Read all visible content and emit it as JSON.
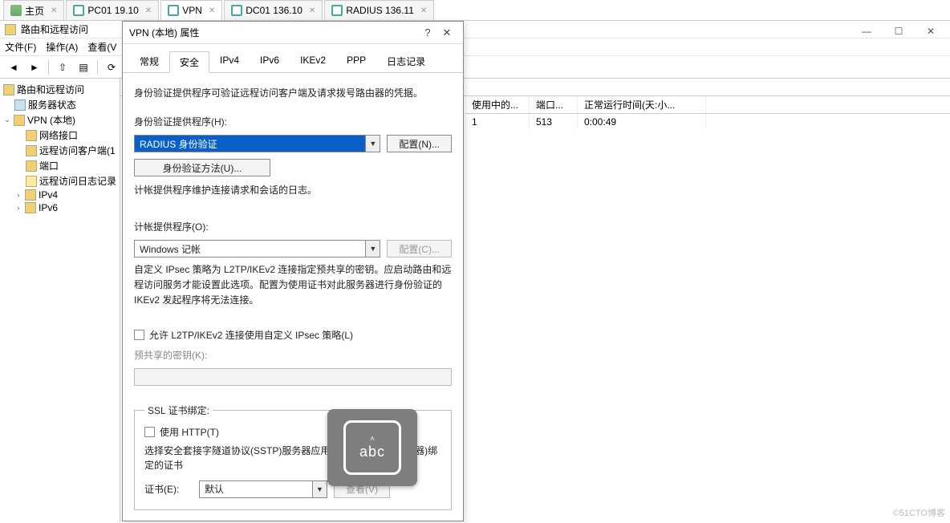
{
  "top_tabs": [
    {
      "label": "主页",
      "type": "home"
    },
    {
      "label": "PC01  19.10",
      "type": "pc"
    },
    {
      "label": "VPN",
      "type": "pc",
      "active": true
    },
    {
      "label": "DC01  136.10",
      "type": "pc"
    },
    {
      "label": "RADIUS  136.11",
      "type": "pc"
    }
  ],
  "mmc_title": "路由和远程访问",
  "menu": {
    "file": "文件(F)",
    "action": "操作(A)",
    "view": "查看(V"
  },
  "tree": {
    "root": "路由和远程访问",
    "server_status": "服务器状态",
    "vpn_local": "VPN (本地)",
    "net_if": "网络接口",
    "ras_clients": "远程访问客户端(1",
    "ports": "端口",
    "ras_log": "远程访问日志记录",
    "ipv4": "IPv4",
    "ipv6": "IPv6"
  },
  "list": {
    "headers": {
      "c1": "使用中的...",
      "c2": "端口...",
      "c3": "正常运行时间(天:小..."
    },
    "row": {
      "c1": "1",
      "c2": "513",
      "c3": "0:00:49"
    }
  },
  "dialog": {
    "title": "VPN (本地) 属性",
    "tabs": {
      "general": "常规",
      "security": "安全",
      "ipv4": "IPv4",
      "ipv6": "IPv6",
      "ikev2": "IKEv2",
      "ppp": "PPP",
      "log": "日志记录"
    },
    "intro": "身份验证提供程序可验证远程访问客户端及请求拨号路由器的凭据。",
    "auth_provider_label": "身份验证提供程序(H):",
    "auth_provider_value": "RADIUS 身份验证",
    "configure_btn": "配置(N)...",
    "auth_methods_btn": "身份验证方法(U)...",
    "acct_intro": "计帐提供程序维护连接请求和会话的日志。",
    "acct_provider_label": "计帐提供程序(O):",
    "acct_provider_value": "Windows 记帐",
    "configure2_btn": "配置(C)...",
    "ipsec_note": "自定义 IPsec 策略为 L2TP/IKEv2 连接指定预共享的密钥。应启动路由和远程访问服务才能设置此选项。配置为使用证书对此服务器进行身份验证的 IKEv2 发起程序将无法连接。",
    "allow_custom_ipsec": "允许 L2TP/IKEv2 连接使用自定义 IPsec 策略(L)",
    "psk_label": "预共享的密钥(K):",
    "ssl_group": "SSL 证书绑定:",
    "use_http": "使用 HTTP(T)",
    "sstp_note": "选择安全套接字隧道协议(SSTP)服务器应用来与 SSL(Web 侦听器)绑定的证书",
    "cert_label": "证书(E):",
    "cert_value": "默认",
    "view_btn": "查看(V)"
  },
  "ime": "abc",
  "watermark": "©51CTO博客"
}
